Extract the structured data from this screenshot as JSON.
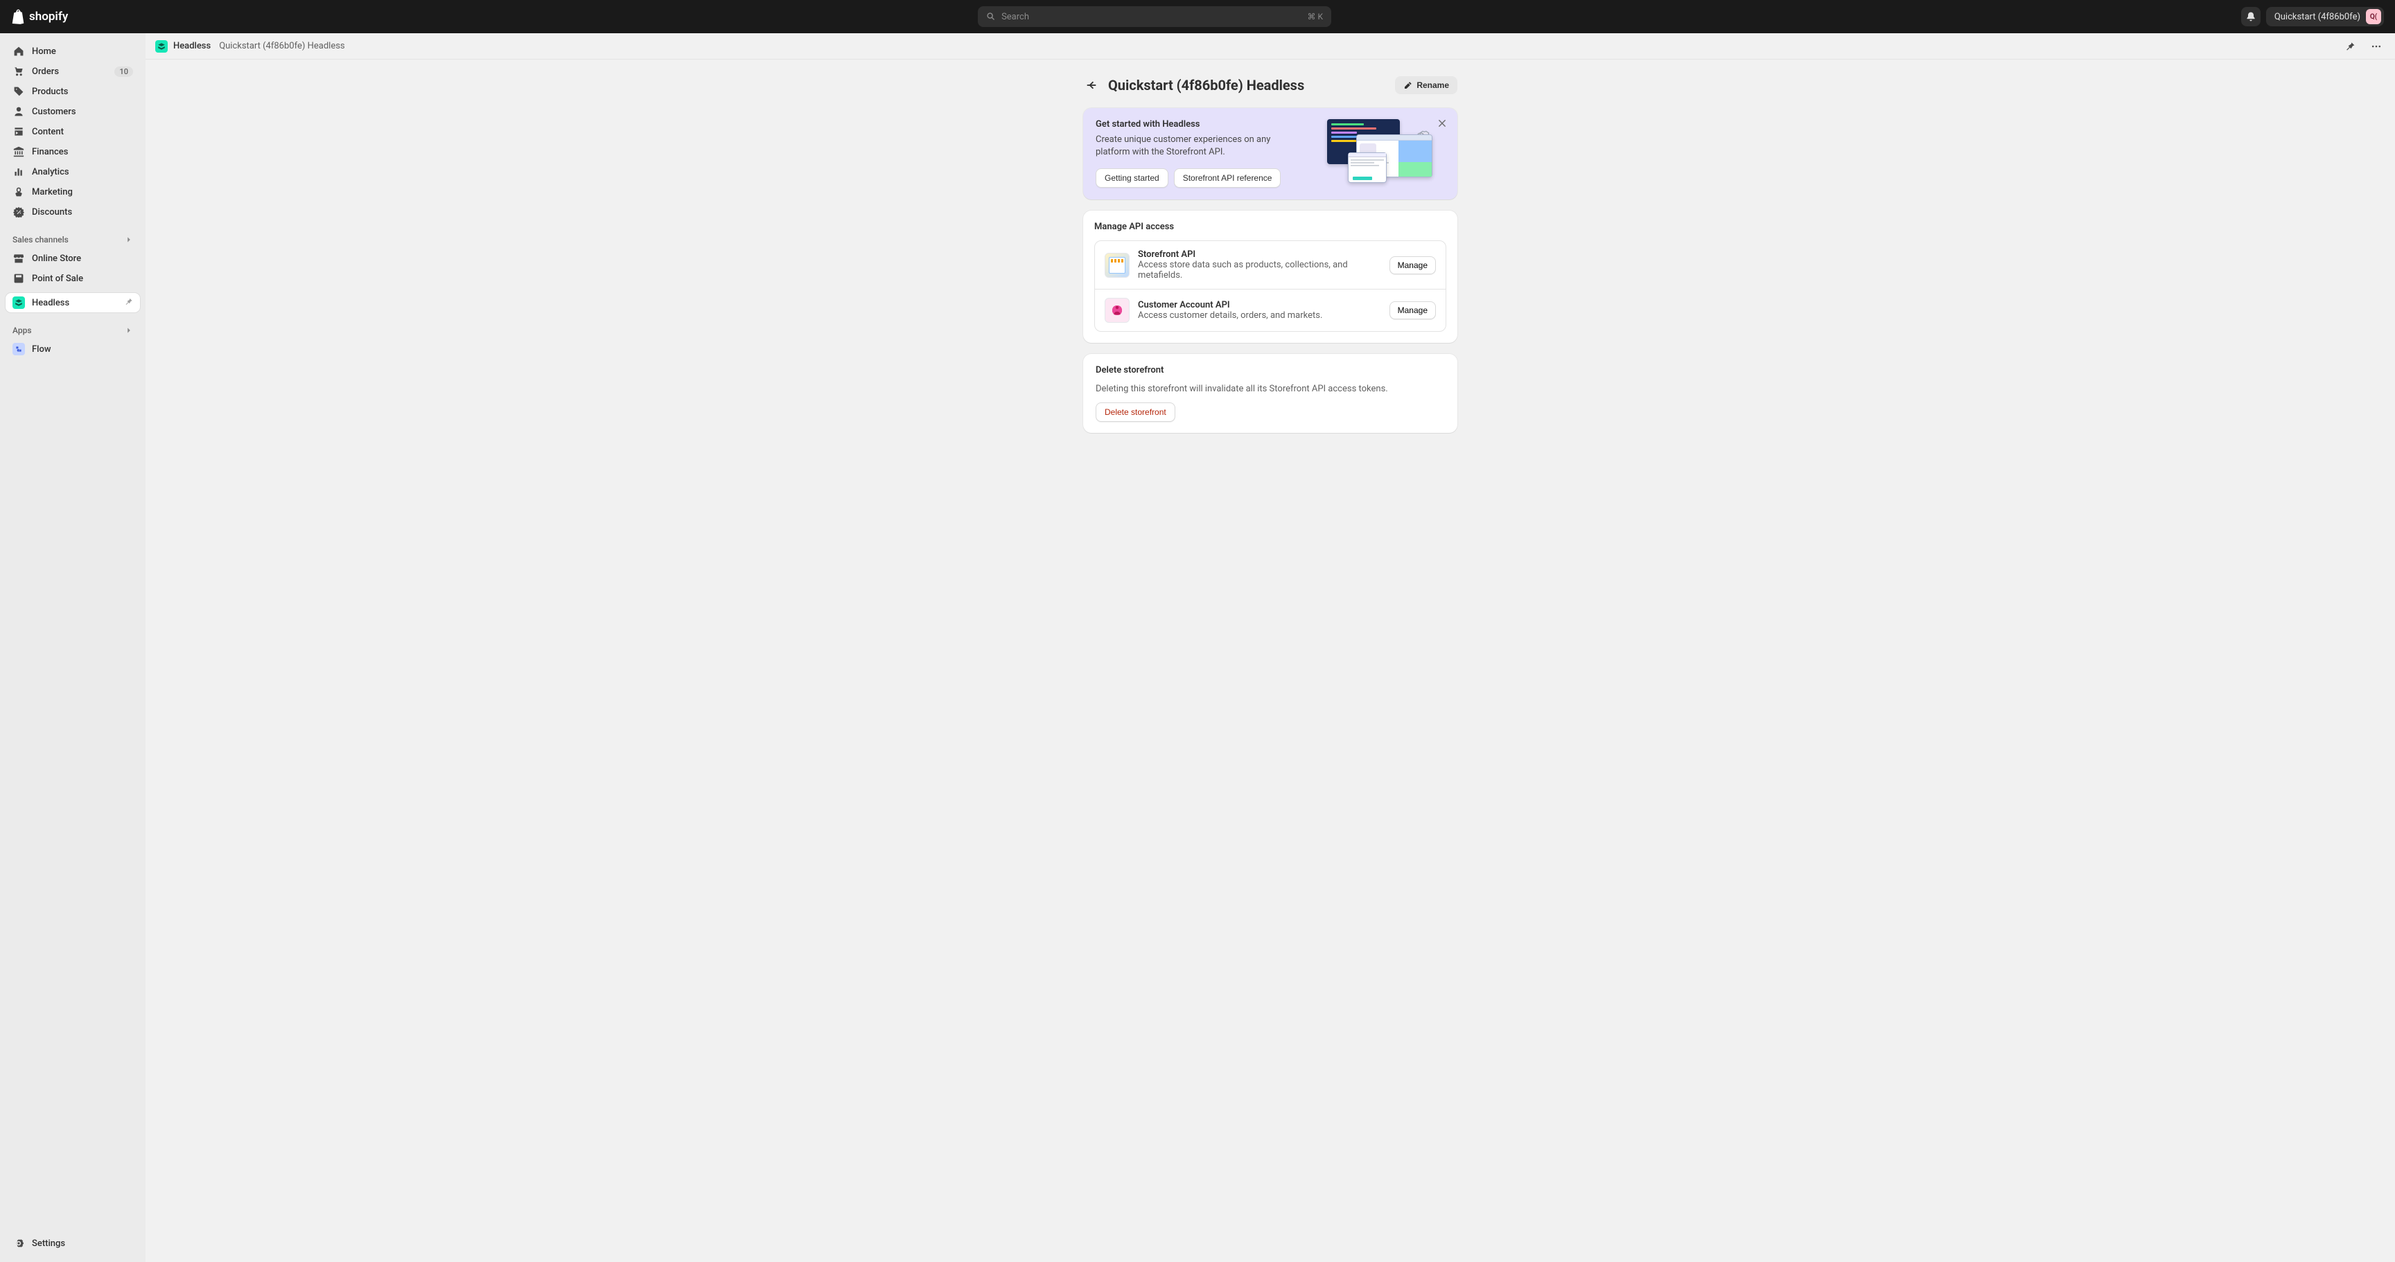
{
  "topbar": {
    "brand": "shopify",
    "search_placeholder": "Search",
    "search_kbd": "⌘ K",
    "store_name": "Quickstart (4f86b0fe)",
    "avatar_initials": "Q("
  },
  "sidebar": {
    "nav": [
      {
        "label": "Home",
        "icon": "home"
      },
      {
        "label": "Orders",
        "icon": "orders",
        "badge": "10"
      },
      {
        "label": "Products",
        "icon": "products"
      },
      {
        "label": "Customers",
        "icon": "customers"
      },
      {
        "label": "Content",
        "icon": "content"
      },
      {
        "label": "Finances",
        "icon": "finances"
      },
      {
        "label": "Analytics",
        "icon": "analytics"
      },
      {
        "label": "Marketing",
        "icon": "marketing"
      },
      {
        "label": "Discounts",
        "icon": "discounts"
      }
    ],
    "channels_header": "Sales channels",
    "channels": [
      {
        "label": "Online Store",
        "icon": "store"
      },
      {
        "label": "Point of Sale",
        "icon": "pos"
      }
    ],
    "headless_label": "Headless",
    "apps_header": "Apps",
    "apps": [
      {
        "label": "Flow"
      }
    ],
    "settings_label": "Settings"
  },
  "breadcrumb": {
    "app_name": "Headless",
    "page_name": "Quickstart (4f86b0fe) Headless"
  },
  "page": {
    "title": "Quickstart (4f86b0fe) Headless",
    "rename_label": "Rename"
  },
  "intro": {
    "title": "Get started with Headless",
    "description": "Create unique customer experiences on any platform with the Storefront API.",
    "getting_started_label": "Getting started",
    "api_ref_label": "Storefront API reference"
  },
  "apiaccess": {
    "title": "Manage API access",
    "manage_label": "Manage",
    "items": [
      {
        "name": "Storefront API",
        "desc": "Access store data such as products, collections, and metafields."
      },
      {
        "name": "Customer Account API",
        "desc": "Access customer details, orders, and markets."
      }
    ]
  },
  "delete": {
    "title": "Delete storefront",
    "desc": "Deleting this storefront will invalidate all its Storefront API access tokens.",
    "button_label": "Delete storefront"
  }
}
